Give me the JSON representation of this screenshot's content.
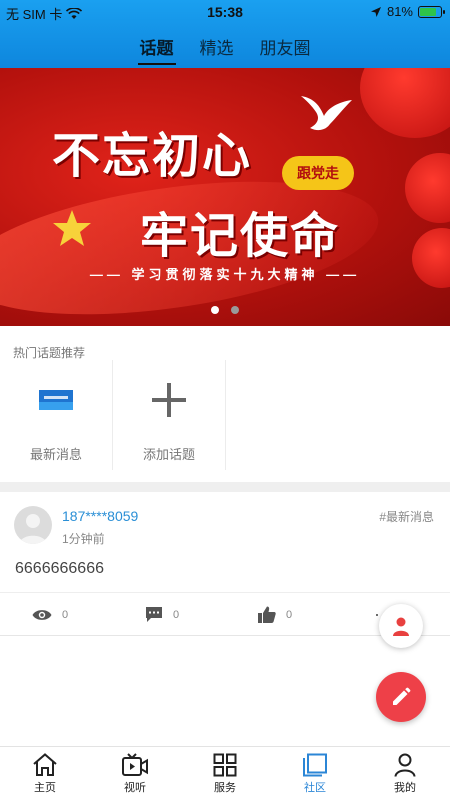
{
  "status_bar": {
    "carrier": "无 SIM 卡",
    "time": "15:38",
    "battery": "81%",
    "battery_level": 0.81
  },
  "header": {
    "tabs": [
      {
        "label": "话题",
        "active": true
      },
      {
        "label": "精选",
        "active": false
      },
      {
        "label": "朋友圈",
        "active": false
      }
    ]
  },
  "banner": {
    "line1": "不忘初心",
    "line2": "牢记使命",
    "badge": "跟党走",
    "slogan": "—— 学习贯彻落实十九大精神 ——",
    "page_count": 2,
    "active_page": 1
  },
  "hot_topics": {
    "heading": "热门话题推荐",
    "items": [
      {
        "label": "最新消息",
        "icon": "news-thumbnail-icon"
      },
      {
        "label": "添加话题",
        "icon": "plus-icon"
      }
    ]
  },
  "post": {
    "user": "187****8059",
    "time_ago": "1分钟前",
    "tag": "#最新消息",
    "content": "6666666666",
    "views": "0",
    "comments": "0",
    "likes": "0",
    "more": "··"
  },
  "bottom_nav": {
    "items": [
      {
        "label": "主页",
        "icon": "home-icon"
      },
      {
        "label": "视听",
        "icon": "video-icon"
      },
      {
        "label": "服务",
        "icon": "grid-icon"
      },
      {
        "label": "社区",
        "icon": "community-icon",
        "active": true
      },
      {
        "label": "我的",
        "icon": "person-icon"
      }
    ]
  },
  "colors": {
    "header_blue": "#1aa0f0",
    "accent_blue": "#2b86d6",
    "fab_red": "#ee4048",
    "banner_red": "#c8150f"
  }
}
